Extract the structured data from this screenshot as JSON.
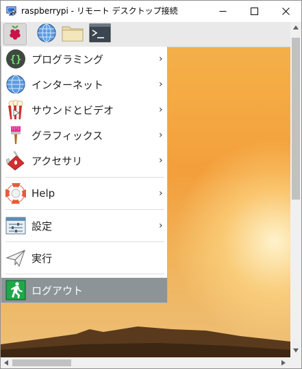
{
  "window": {
    "title": "raspberrypi - リモート デスクトップ接続",
    "icons": [
      "remote-desktop-icon",
      "minimize-icon",
      "maximize-icon",
      "close-icon"
    ]
  },
  "panel": {
    "launchers": [
      {
        "name": "raspberry-menu-button",
        "icon": "raspberry-icon"
      },
      {
        "name": "web-browser-button",
        "icon": "globe-icon"
      },
      {
        "name": "file-manager-button",
        "icon": "folder-icon"
      },
      {
        "name": "terminal-button",
        "icon": "terminal-icon"
      }
    ]
  },
  "menu": {
    "items": [
      {
        "label": "プログラミング",
        "icon": "programming-icon",
        "submenu": true
      },
      {
        "label": "インターネット",
        "icon": "globe-icon",
        "submenu": true
      },
      {
        "label": "サウンドとビデオ",
        "icon": "popcorn-icon",
        "submenu": true
      },
      {
        "label": "グラフィックス",
        "icon": "paintbrush-icon",
        "submenu": true
      },
      {
        "label": "アクセサリ",
        "icon": "pocket-knife-icon",
        "submenu": true
      },
      {
        "label": "Help",
        "icon": "lifebuoy-icon",
        "submenu": true
      },
      {
        "label": "設定",
        "icon": "settings-icon",
        "submenu": true
      },
      {
        "label": "実行",
        "icon": "paper-plane-icon",
        "submenu": false
      },
      {
        "label": "ログアウト",
        "icon": "exit-icon",
        "submenu": false,
        "selected": true
      }
    ],
    "arrow": "›"
  },
  "colors": {
    "selected_item_bg": "#8c9498",
    "desktop_orange": "#f5ab43"
  }
}
